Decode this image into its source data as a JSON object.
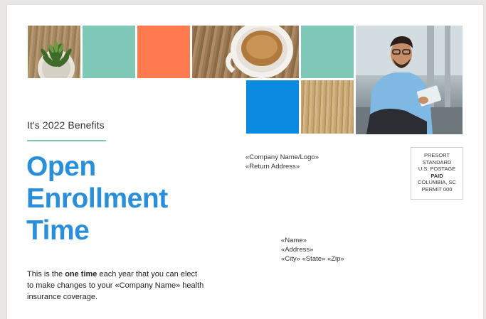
{
  "header": {
    "subtitle": "It's 2022 Benefits",
    "headline_lines": [
      "Open",
      "Enrollment",
      "Time"
    ]
  },
  "body": {
    "intro": "This is the ",
    "emphasis": "one time",
    "rest": " each year that you can elect to make changes to your «Company Name» health insurance coverage."
  },
  "return_address": [
    "«Company Name/Logo»",
    "«Return Address»"
  ],
  "postage": [
    "PRESORT",
    "STANDARD",
    "U.S. POSTAGE",
    "PAID",
    "COLUMBIA, SC",
    "PERMIT 000"
  ],
  "recipient": [
    "«Name»",
    "«Address»",
    "«City» «State» «Zip»"
  ],
  "colors": {
    "headline_blue": "#2a8fd8",
    "teal": "#7fc8b8",
    "orange": "#ff7a4f",
    "bright_blue": "#0a8be0"
  },
  "images": [
    "succulent-plant",
    "coffee-cup",
    "wood-texture",
    "man-with-tablet"
  ]
}
